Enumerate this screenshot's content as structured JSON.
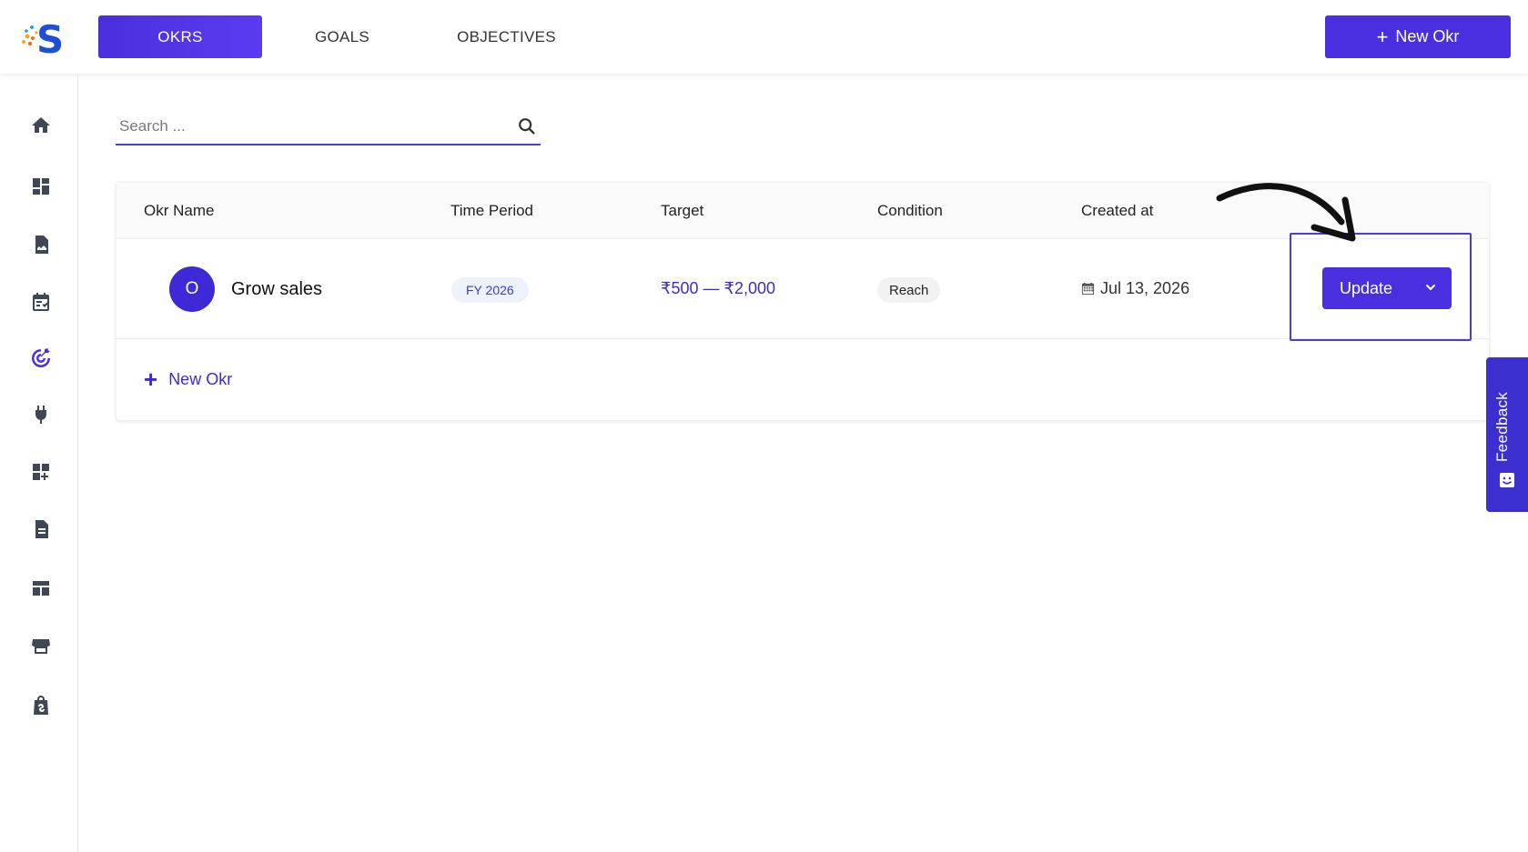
{
  "app": {
    "logo_letter": "S"
  },
  "nav": {
    "tabs": [
      {
        "label": "OKRS",
        "active": true
      },
      {
        "label": "GOALS",
        "active": false
      },
      {
        "label": "OBJECTIVES",
        "active": false
      }
    ],
    "new_okr_label": "New Okr"
  },
  "sidebar": {
    "items": [
      {
        "icon": "home-icon"
      },
      {
        "icon": "dashboard-icon"
      },
      {
        "icon": "report-icon"
      },
      {
        "icon": "calendar-task-icon"
      },
      {
        "icon": "target-icon",
        "active": true
      },
      {
        "icon": "plug-icon"
      },
      {
        "icon": "add-widget-icon"
      },
      {
        "icon": "document-icon"
      },
      {
        "icon": "layout-icon"
      },
      {
        "icon": "store-icon"
      },
      {
        "icon": "shopping-bag-icon"
      }
    ]
  },
  "search": {
    "placeholder": "Search ..."
  },
  "table": {
    "headers": [
      "Okr Name",
      "Time Period",
      "Target",
      "Condition",
      "Created at"
    ],
    "rows": [
      {
        "avatar": "O",
        "name": "Grow sales",
        "period": "FY 2026",
        "target": "₹500 — ₹2,000",
        "condition": "Reach",
        "created": "Jul 13, 2026",
        "action_label": "Update"
      }
    ],
    "new_okr_label": "New Okr"
  },
  "feedback": {
    "label": "Feedback"
  },
  "colors": {
    "accent": "#4a2fe0",
    "accent_text": "#3d2ad6"
  }
}
